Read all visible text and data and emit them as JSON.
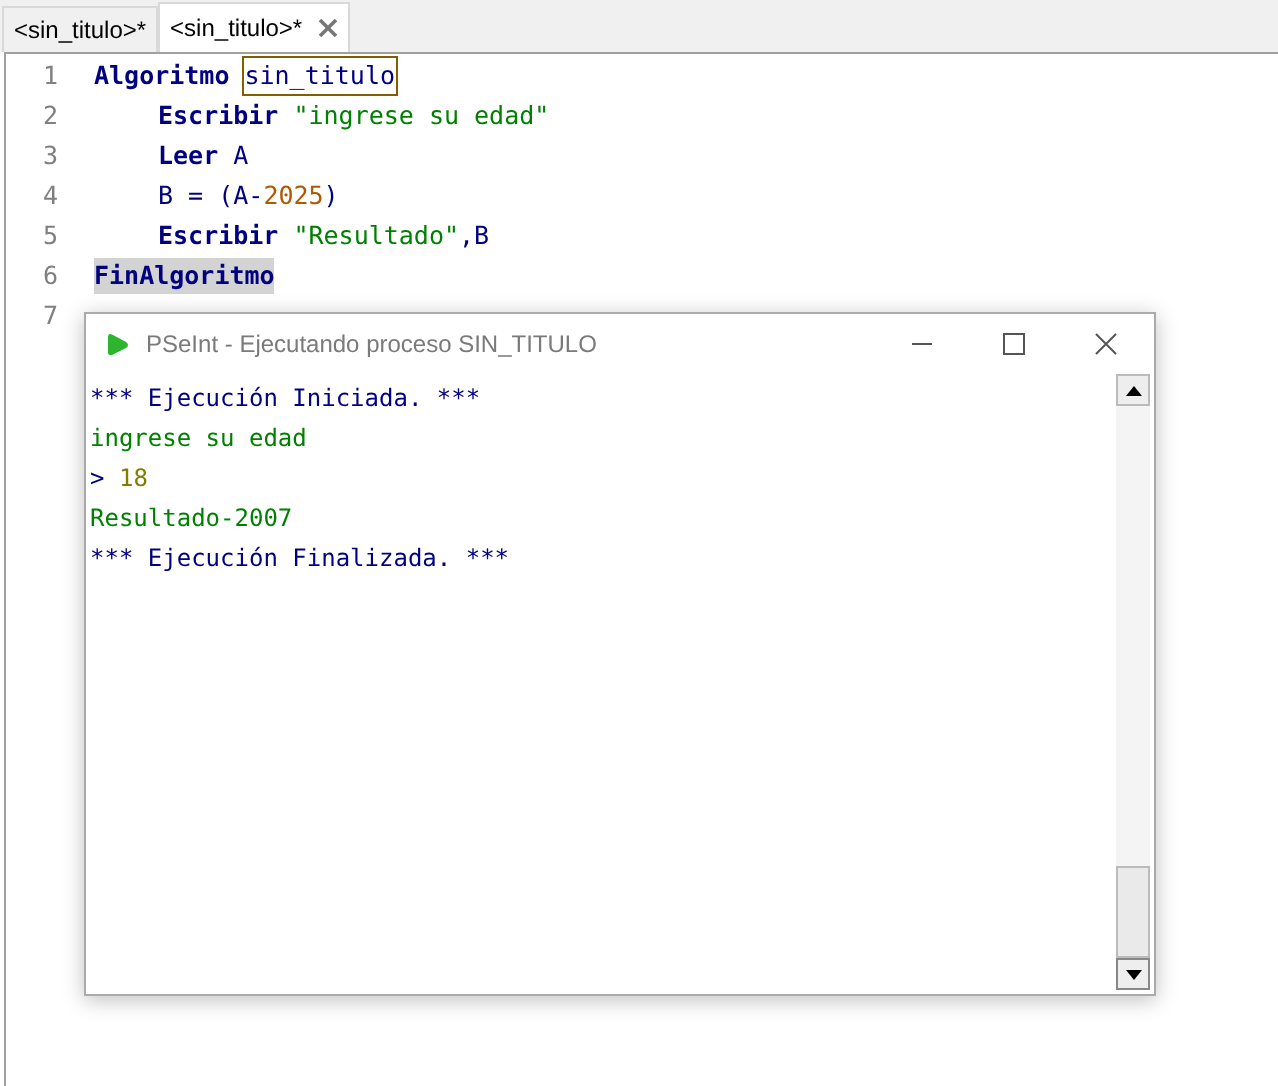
{
  "tabs": [
    {
      "label": "<sin_titulo>*",
      "selected": false,
      "closable": false
    },
    {
      "label": "<sin_titulo>*",
      "selected": true,
      "closable": true
    }
  ],
  "editor": {
    "lines": [
      {
        "number": "1",
        "indent": false,
        "tokens": [
          {
            "text": "Algoritmo",
            "kind": "keyword"
          },
          {
            "text": "sin_titulo",
            "kind": "plain",
            "boxed": true,
            "spaced": true
          }
        ]
      },
      {
        "number": "2",
        "indent": true,
        "tokens": [
          {
            "text": "Escribir",
            "kind": "keyword"
          },
          {
            "text": "\"ingrese su edad\"",
            "kind": "string",
            "spaced": true
          }
        ]
      },
      {
        "number": "3",
        "indent": true,
        "tokens": [
          {
            "text": "Leer",
            "kind": "keyword"
          },
          {
            "text": "A",
            "kind": "plain",
            "spaced": true
          }
        ]
      },
      {
        "number": "4",
        "indent": true,
        "tokens": [
          {
            "text": "B = (A-",
            "kind": "plain"
          },
          {
            "text": "2025",
            "kind": "number"
          },
          {
            "text": ")",
            "kind": "plain"
          }
        ]
      },
      {
        "number": "5",
        "indent": true,
        "tokens": [
          {
            "text": "Escribir",
            "kind": "keyword"
          },
          {
            "text": "\"Resultado\"",
            "kind": "string",
            "spaced": true
          },
          {
            "text": ",B",
            "kind": "plain"
          }
        ]
      },
      {
        "number": "6",
        "indent": false,
        "tokens": [
          {
            "text": "FinAlgoritmo",
            "kind": "keyword",
            "shaded": true
          }
        ]
      },
      {
        "number": "7"
      }
    ]
  },
  "console": {
    "title": "PSeInt - Ejecutando proceso SIN_TITULO",
    "lines": [
      {
        "kind": "system",
        "text": "*** Ejecución Iniciada. ***"
      },
      {
        "kind": "output",
        "text": "ingrese su edad"
      },
      {
        "kind": "input",
        "prompt": ">",
        "text": "18"
      },
      {
        "kind": "output",
        "text": "Resultado-2007"
      },
      {
        "kind": "system",
        "text": "*** Ejecución Finalizada. ***"
      }
    ]
  }
}
